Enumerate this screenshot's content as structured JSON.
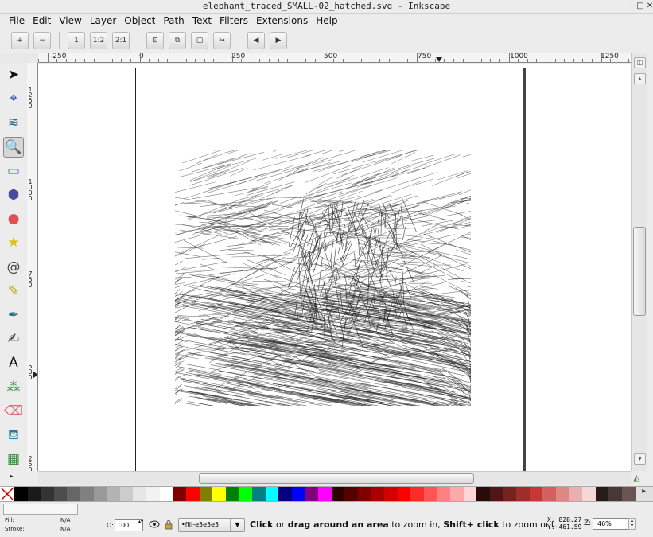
{
  "window": {
    "title": "elephant_traced_SMALL-02_hatched.svg - Inkscape",
    "min": "–",
    "max": "□",
    "close": "✕"
  },
  "menu": [
    "File",
    "Edit",
    "View",
    "Layer",
    "Object",
    "Path",
    "Text",
    "Filters",
    "Extensions",
    "Help"
  ],
  "toolcontrols": [
    {
      "name": "zoom-in-button",
      "glyph": "+"
    },
    {
      "name": "zoom-out-button",
      "glyph": "−"
    },
    {
      "name": "zoom-1-to-1-button",
      "glyph": "1"
    },
    {
      "name": "zoom-1-to-2-button",
      "glyph": "1:2"
    },
    {
      "name": "zoom-2-to-1-button",
      "glyph": "2:1"
    },
    {
      "name": "zoom-selection-button",
      "glyph": "⊡"
    },
    {
      "name": "zoom-drawing-button",
      "glyph": "⧉"
    },
    {
      "name": "zoom-page-button",
      "glyph": "▢"
    },
    {
      "name": "zoom-page-width-button",
      "glyph": "↔"
    },
    {
      "name": "zoom-previous-button",
      "glyph": "◀"
    },
    {
      "name": "zoom-next-button",
      "glyph": "▶"
    }
  ],
  "ruler": {
    "h_labels": [
      "-250",
      "0",
      "250",
      "500",
      "750",
      "1000",
      "1250"
    ],
    "v_labels": [
      "1250",
      "1000",
      "750",
      "500",
      "250"
    ]
  },
  "tools": [
    {
      "name": "selector-tool-icon",
      "glyph": "➤"
    },
    {
      "name": "node-tool-icon",
      "glyph": "⌖"
    },
    {
      "name": "tweak-tool-icon",
      "glyph": "≋"
    },
    {
      "name": "zoom-tool-icon",
      "glyph": "🔍"
    },
    {
      "name": "rectangle-tool-icon",
      "glyph": "▭"
    },
    {
      "name": "3d-box-tool-icon",
      "glyph": "⬢"
    },
    {
      "name": "ellipse-tool-icon",
      "glyph": "●"
    },
    {
      "name": "star-tool-icon",
      "glyph": "★"
    },
    {
      "name": "spiral-tool-icon",
      "glyph": "@"
    },
    {
      "name": "pencil-tool-icon",
      "glyph": "✎"
    },
    {
      "name": "pen-tool-icon",
      "glyph": "✒"
    },
    {
      "name": "calligraphy-tool-icon",
      "glyph": "✍"
    },
    {
      "name": "text-tool-icon",
      "glyph": "A"
    },
    {
      "name": "spray-tool-icon",
      "glyph": "⁂"
    },
    {
      "name": "eraser-tool-icon",
      "glyph": "⌫"
    },
    {
      "name": "paint-bucket-tool-icon",
      "glyph": "⛾"
    },
    {
      "name": "gradient-tool-icon",
      "glyph": "▦"
    }
  ],
  "palette": {
    "none_color": "#cc0000",
    "colors": [
      "#000000",
      "#1a1a1a",
      "#333333",
      "#4d4d4d",
      "#666666",
      "#808080",
      "#999999",
      "#b3b3b3",
      "#cccccc",
      "#e6e6e6",
      "#f2f2f2",
      "#ffffff",
      "#800000",
      "#ff0000",
      "#808000",
      "#ffff00",
      "#008000",
      "#00ff00",
      "#008080",
      "#00ffff",
      "#000080",
      "#0000ff",
      "#800080",
      "#ff00ff",
      "#2b0000",
      "#550000",
      "#800000",
      "#aa0000",
      "#d40000",
      "#ff0000",
      "#ff2a2a",
      "#ff5555",
      "#ff8080",
      "#ffaaaa",
      "#ffd5d5",
      "#280b0b",
      "#501616",
      "#782121",
      "#a02c2c",
      "#c83737",
      "#d35f5f",
      "#de8787",
      "#e9afaf",
      "#f4d7d7",
      "#241c1c",
      "#483737",
      "#6c5353"
    ],
    "end_glyph": "▸"
  },
  "status": {
    "fill_label": "Fill:",
    "fill_value": "N/A",
    "stroke_label": "Stroke:",
    "stroke_value": "N/A",
    "opacity_label": "O:",
    "opacity_value": "100",
    "layer": "•fill-e3e3e3",
    "msg_click": "Click",
    "msg_or": " or ",
    "msg_drag": "drag around an area",
    "msg_zoomin": " to zoom in, ",
    "msg_shift": "Shift+ click",
    "msg_zoomout": " to zoom out.",
    "x_label": "X:",
    "x_value": "828.27",
    "y_label": "Y:",
    "y_value": "461.59",
    "zoom_label": "Z:",
    "zoom_value": "46%"
  }
}
